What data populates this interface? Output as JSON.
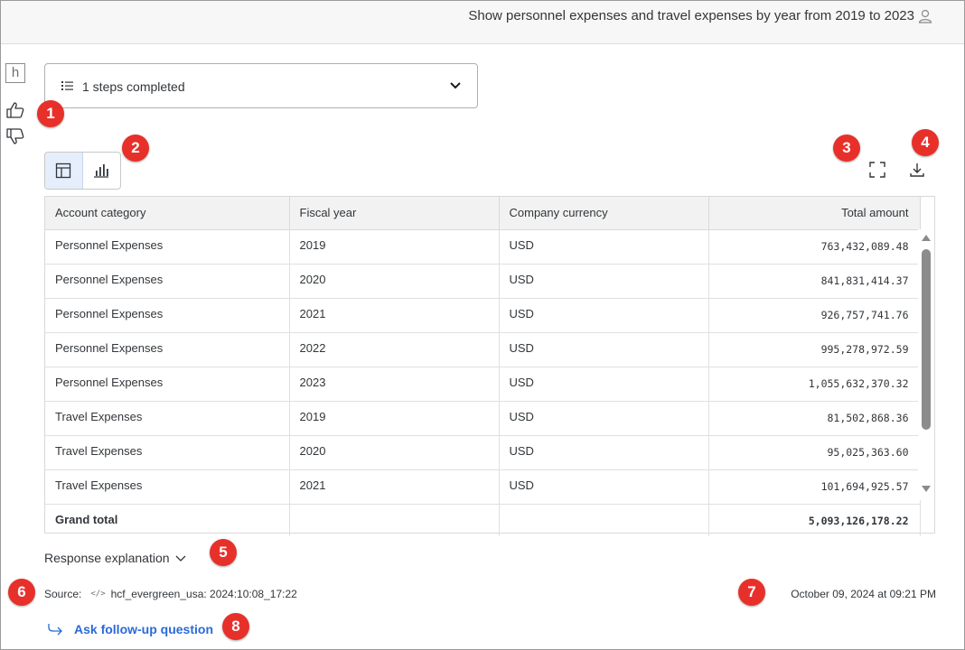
{
  "header": {
    "query": "Show personnel expenses and travel expenses by year from 2019 to 2023",
    "user_icon": "user-icon"
  },
  "sidebar": {
    "logo": "h",
    "like_icon": "thumbs-up-icon",
    "dislike_icon": "thumbs-down-icon"
  },
  "steps": {
    "label": "1 steps completed",
    "icon": "list-icon",
    "chevron": "chevron-down-icon"
  },
  "view_toggle": {
    "options": [
      "table-view-icon",
      "chart-view-icon"
    ],
    "selected": "table-view-icon"
  },
  "actions": {
    "expand_icon": "fullscreen-icon",
    "download_icon": "download-icon"
  },
  "table": {
    "columns": [
      "Account category",
      "Fiscal year",
      "Company currency",
      "Total amount"
    ],
    "rows": [
      [
        "Personnel Expenses",
        "2019",
        "USD",
        "763,432,089.48"
      ],
      [
        "Personnel Expenses",
        "2020",
        "USD",
        "841,831,414.37"
      ],
      [
        "Personnel Expenses",
        "2021",
        "USD",
        "926,757,741.76"
      ],
      [
        "Personnel Expenses",
        "2022",
        "USD",
        "995,278,972.59"
      ],
      [
        "Personnel Expenses",
        "2023",
        "USD",
        "1,055,632,370.32"
      ],
      [
        "Travel Expenses",
        "2019",
        "USD",
        "81,502,868.36"
      ],
      [
        "Travel Expenses",
        "2020",
        "USD",
        "95,025,363.60"
      ],
      [
        "Travel Expenses",
        "2021",
        "USD",
        "101,694,925.57"
      ]
    ],
    "total_label": "Grand total",
    "total_value": "5,093,126,178.22"
  },
  "response_explanation": {
    "label": "Response explanation"
  },
  "source": {
    "label": "Source:",
    "code_glyph": "</>",
    "value": "hcf_evergreen_usa: 2024:10:08_17:22"
  },
  "timestamp": "October 09, 2024 at 09:21 PM",
  "followup": {
    "label": "Ask follow-up question"
  },
  "annotations": [
    "1",
    "2",
    "3",
    "4",
    "5",
    "6",
    "7",
    "8"
  ],
  "colors": {
    "accent": "#2a6ad8",
    "badge": "#e8302a",
    "toggle_active": "#e5eefb"
  }
}
